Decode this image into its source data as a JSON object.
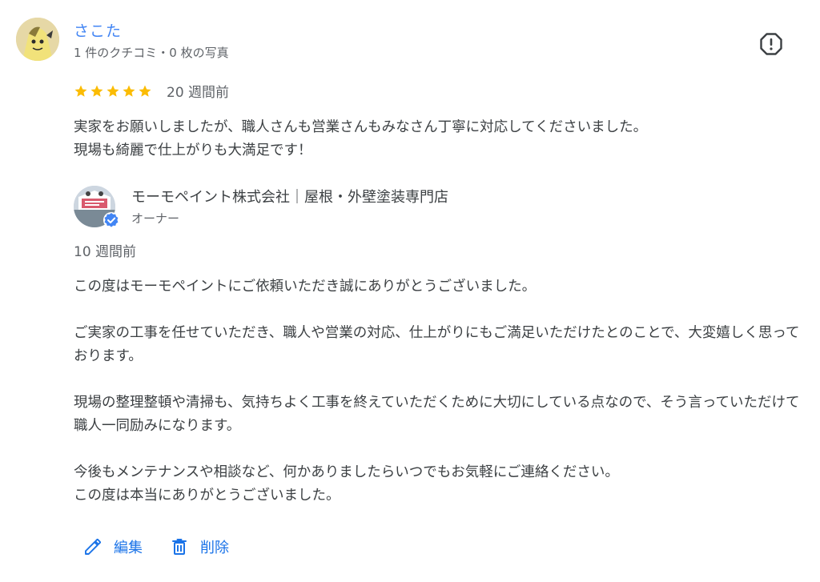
{
  "review": {
    "reviewer_name": "さこた",
    "reviewer_meta": "1 件のクチコミ・0 枚の写真",
    "rating": 5,
    "date": "20 週間前",
    "text_lines": [
      "実家をお願いしましたが、職人さんも営業さんもみなさん丁寧に対応してくださいました。",
      "現場も綺麗で仕上がりも大満足です！"
    ],
    "star_color": "#fbbc04"
  },
  "owner_reply": {
    "name": "モーモペイント株式会社｜屋根・外壁塗装専門店",
    "role": "オーナー",
    "date": "10 週間前",
    "paragraphs": [
      "この度はモーモペイントにご依頼いただき誠にありがとうございました。",
      "ご実家の工事を任せていただき、職人や営業の対応、仕上がりにもご満足いただけたとのことで、大変嬉しく思っております。",
      "現場の整理整頓や清掃も、気持ちよく工事を終えていただくために大切にしている点なので、そう言っていただけて職人一同励みになります。",
      "今後もメンテナンスや相談など、何かありましたらいつでもお気軽にご連絡ください。\nこの度は本当にありがとうございました。"
    ],
    "verified_color": "#4285f4"
  },
  "actions": {
    "edit_label": "編集",
    "delete_label": "削除",
    "accent_color": "#1a73e8"
  },
  "icons": {
    "flag": "report-flag-icon",
    "edit": "pencil-icon",
    "delete": "trash-icon",
    "star": "star-icon",
    "verified": "verified-check-icon"
  }
}
